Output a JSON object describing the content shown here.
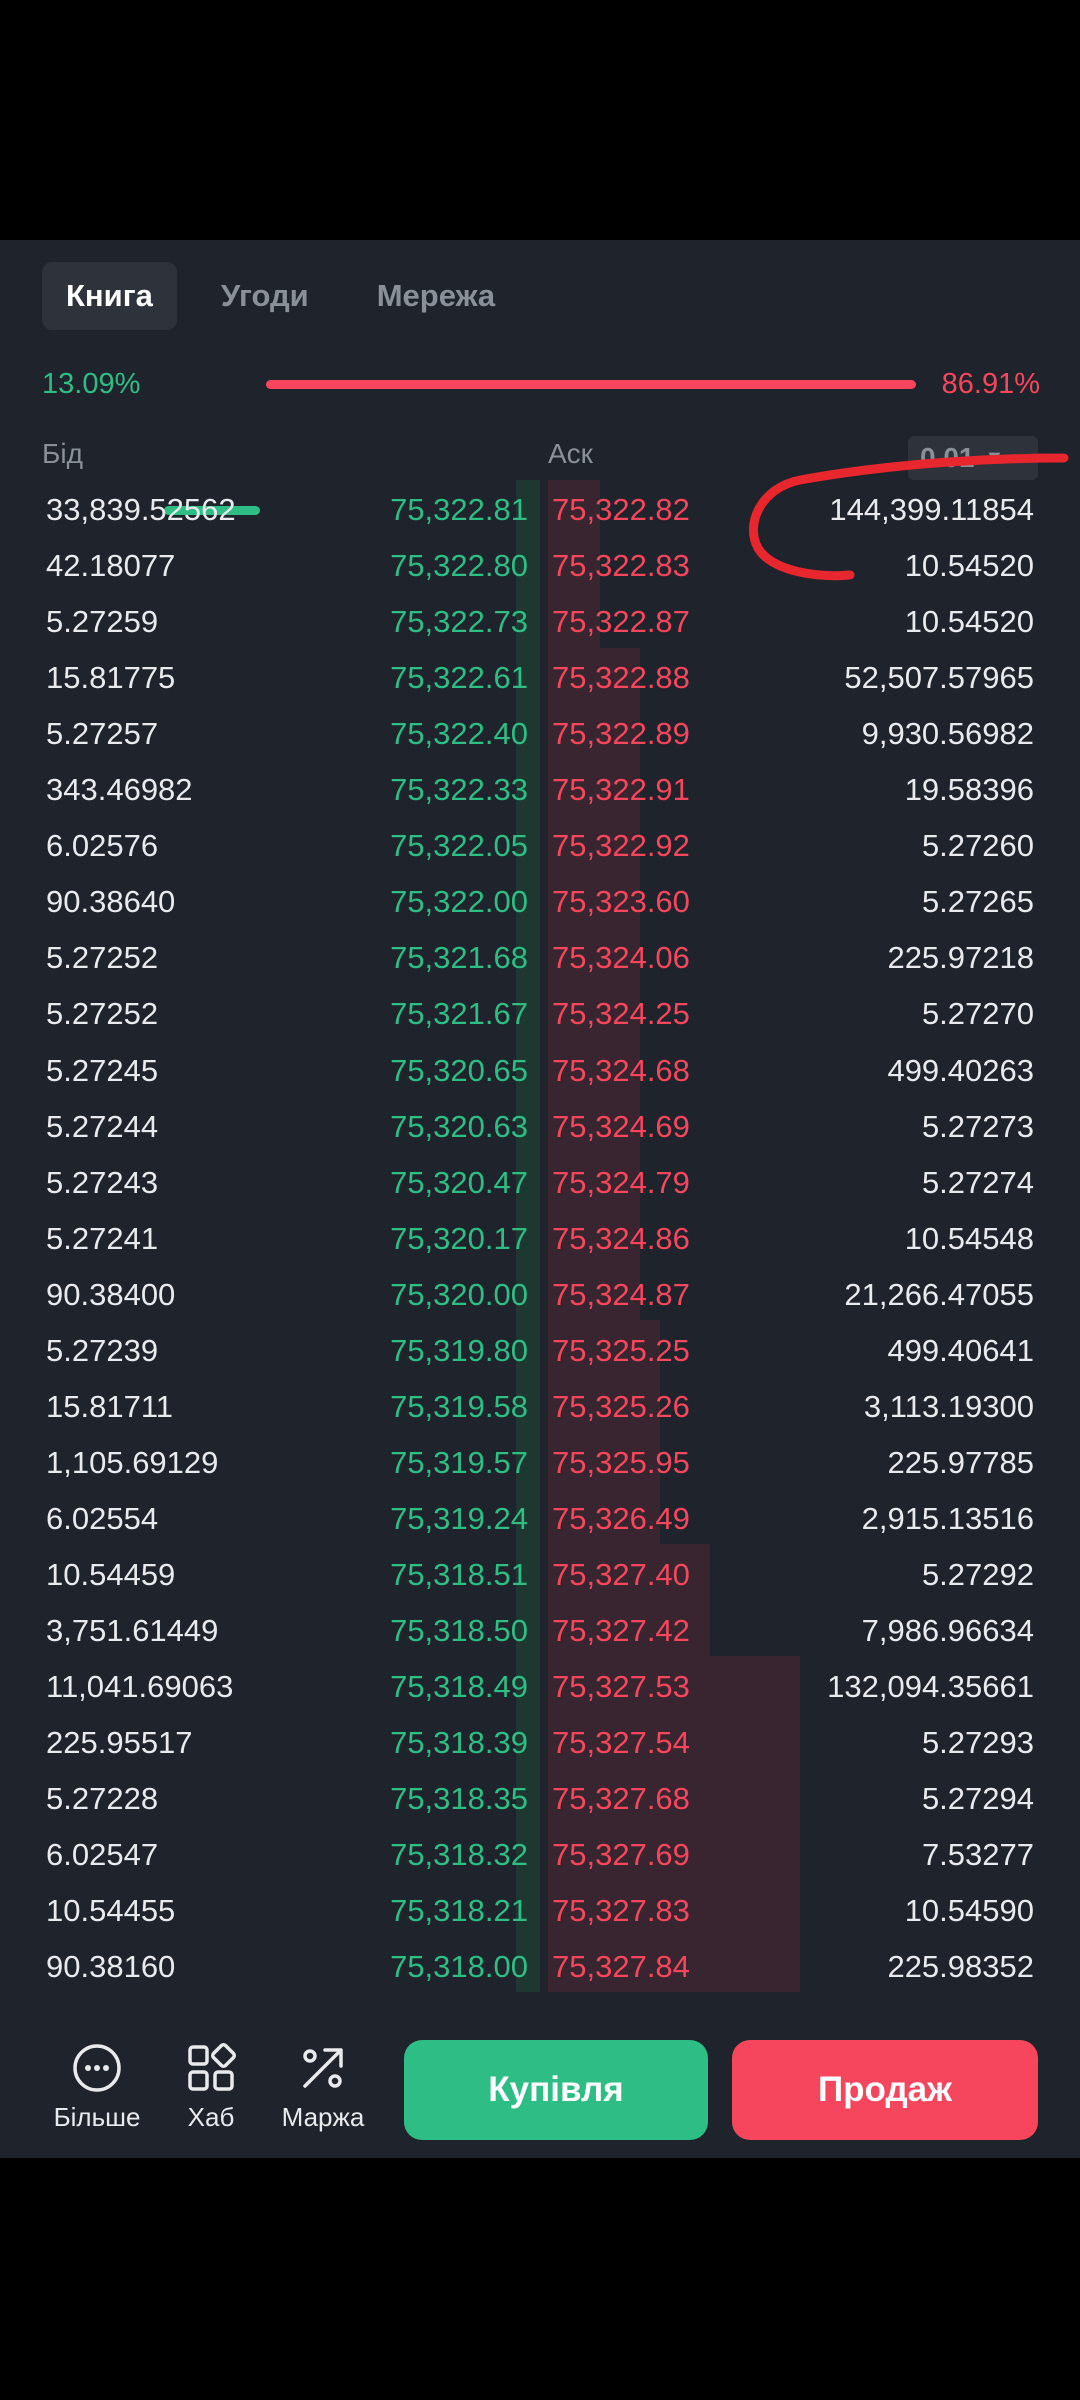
{
  "tabs": [
    "Книга",
    "Угоди",
    "Мережа"
  ],
  "ratio": {
    "bid_pct": "13.09%",
    "ask_pct": "86.91%",
    "bid_fraction": 0.1309
  },
  "headers": {
    "bid": "Бід",
    "ask": "Аск",
    "precision": "0.01",
    "precision_caret": "▼"
  },
  "orders": [
    {
      "bid_qty": "33,839.52562",
      "bid_price": "75,322.81",
      "ask_price": "75,322.82",
      "ask_qty": "144,399.11854"
    },
    {
      "bid_qty": "42.18077",
      "bid_price": "75,322.80",
      "ask_price": "75,322.83",
      "ask_qty": "10.54520"
    },
    {
      "bid_qty": "5.27259",
      "bid_price": "75,322.73",
      "ask_price": "75,322.87",
      "ask_qty": "10.54520"
    },
    {
      "bid_qty": "15.81775",
      "bid_price": "75,322.61",
      "ask_price": "75,322.88",
      "ask_qty": "52,507.57965"
    },
    {
      "bid_qty": "5.27257",
      "bid_price": "75,322.40",
      "ask_price": "75,322.89",
      "ask_qty": "9,930.56982"
    },
    {
      "bid_qty": "343.46982",
      "bid_price": "75,322.33",
      "ask_price": "75,322.91",
      "ask_qty": "19.58396"
    },
    {
      "bid_qty": "6.02576",
      "bid_price": "75,322.05",
      "ask_price": "75,322.92",
      "ask_qty": "5.27260"
    },
    {
      "bid_qty": "90.38640",
      "bid_price": "75,322.00",
      "ask_price": "75,323.60",
      "ask_qty": "5.27265"
    },
    {
      "bid_qty": "5.27252",
      "bid_price": "75,321.68",
      "ask_price": "75,324.06",
      "ask_qty": "225.97218"
    },
    {
      "bid_qty": "5.27252",
      "bid_price": "75,321.67",
      "ask_price": "75,324.25",
      "ask_qty": "5.27270"
    },
    {
      "bid_qty": "5.27245",
      "bid_price": "75,320.65",
      "ask_price": "75,324.68",
      "ask_qty": "499.40263"
    },
    {
      "bid_qty": "5.27244",
      "bid_price": "75,320.63",
      "ask_price": "75,324.69",
      "ask_qty": "5.27273"
    },
    {
      "bid_qty": "5.27243",
      "bid_price": "75,320.47",
      "ask_price": "75,324.79",
      "ask_qty": "5.27274"
    },
    {
      "bid_qty": "5.27241",
      "bid_price": "75,320.17",
      "ask_price": "75,324.86",
      "ask_qty": "10.54548"
    },
    {
      "bid_qty": "90.38400",
      "bid_price": "75,320.00",
      "ask_price": "75,324.87",
      "ask_qty": "21,266.47055"
    },
    {
      "bid_qty": "5.27239",
      "bid_price": "75,319.80",
      "ask_price": "75,325.25",
      "ask_qty": "499.40641"
    },
    {
      "bid_qty": "15.81711",
      "bid_price": "75,319.58",
      "ask_price": "75,325.26",
      "ask_qty": "3,113.19300"
    },
    {
      "bid_qty": "1,105.69129",
      "bid_price": "75,319.57",
      "ask_price": "75,325.95",
      "ask_qty": "225.97785"
    },
    {
      "bid_qty": "6.02554",
      "bid_price": "75,319.24",
      "ask_price": "75,326.49",
      "ask_qty": "2,915.13516"
    },
    {
      "bid_qty": "10.54459",
      "bid_price": "75,318.51",
      "ask_price": "75,327.40",
      "ask_qty": "5.27292"
    },
    {
      "bid_qty": "3,751.61449",
      "bid_price": "75,318.50",
      "ask_price": "75,327.42",
      "ask_qty": "7,986.96634"
    },
    {
      "bid_qty": "11,041.69063",
      "bid_price": "75,318.49",
      "ask_price": "75,327.53",
      "ask_qty": "132,094.35661"
    },
    {
      "bid_qty": "225.95517",
      "bid_price": "75,318.39",
      "ask_price": "75,327.54",
      "ask_qty": "5.27293"
    },
    {
      "bid_qty": "5.27228",
      "bid_price": "75,318.35",
      "ask_price": "75,327.68",
      "ask_qty": "5.27294"
    },
    {
      "bid_qty": "6.02547",
      "bid_price": "75,318.32",
      "ask_price": "75,327.69",
      "ask_qty": "7.53277"
    },
    {
      "bid_qty": "10.54455",
      "bid_price": "75,318.21",
      "ask_price": "75,327.83",
      "ask_qty": "10.54590"
    },
    {
      "bid_qty": "90.38160",
      "bid_price": "75,318.00",
      "ask_price": "75,327.84",
      "ask_qty": "225.98352"
    }
  ],
  "bottom_nav": [
    {
      "label": "Більше",
      "icon": "more-icon"
    },
    {
      "label": "Хаб",
      "icon": "hub-icon"
    },
    {
      "label": "Маржа",
      "icon": "margin-icon"
    }
  ],
  "actions": {
    "buy": "Купівля",
    "sell": "Продаж"
  },
  "colors": {
    "bid": "#2dbd85",
    "ask": "#f6465d",
    "background": "#1f232b",
    "annotation": "#e8262d"
  }
}
